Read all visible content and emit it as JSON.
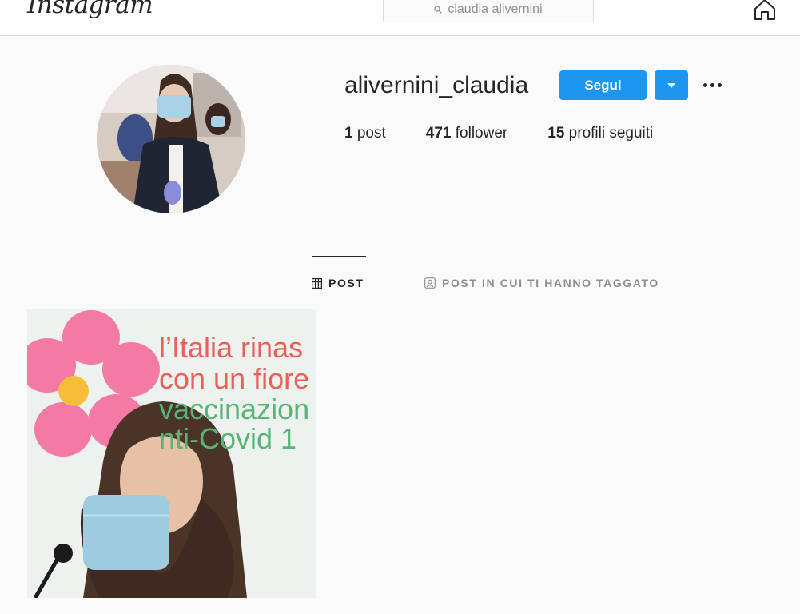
{
  "header": {
    "logo_text": "Instagram",
    "search": {
      "value": "claudia alivernini",
      "icon": "search-icon"
    },
    "home_icon": "home-icon"
  },
  "profile": {
    "username": "alivernini_claudia",
    "follow_label": "Segui",
    "stats": [
      {
        "count": "1",
        "label": "post"
      },
      {
        "count": "471",
        "label": "follower"
      },
      {
        "count": "15",
        "label": "profili seguiti"
      }
    ]
  },
  "tabs": [
    {
      "label": "POST",
      "icon": "grid-icon",
      "active": true
    },
    {
      "label": "POST IN CUI TI HANNO TAGGATO",
      "icon": "tagged-icon",
      "active": false
    }
  ],
  "posts": [
    {
      "overlay_lines": [
        "l’Italia rinas",
        "con un fiore",
        "vaccinazion",
        "nti-Covid 1"
      ]
    }
  ],
  "colors": {
    "accent": "#1d96f0",
    "text": "#262626",
    "muted": "#8e8e8e",
    "border": "#dbdbdb",
    "background": "#fafafa"
  }
}
